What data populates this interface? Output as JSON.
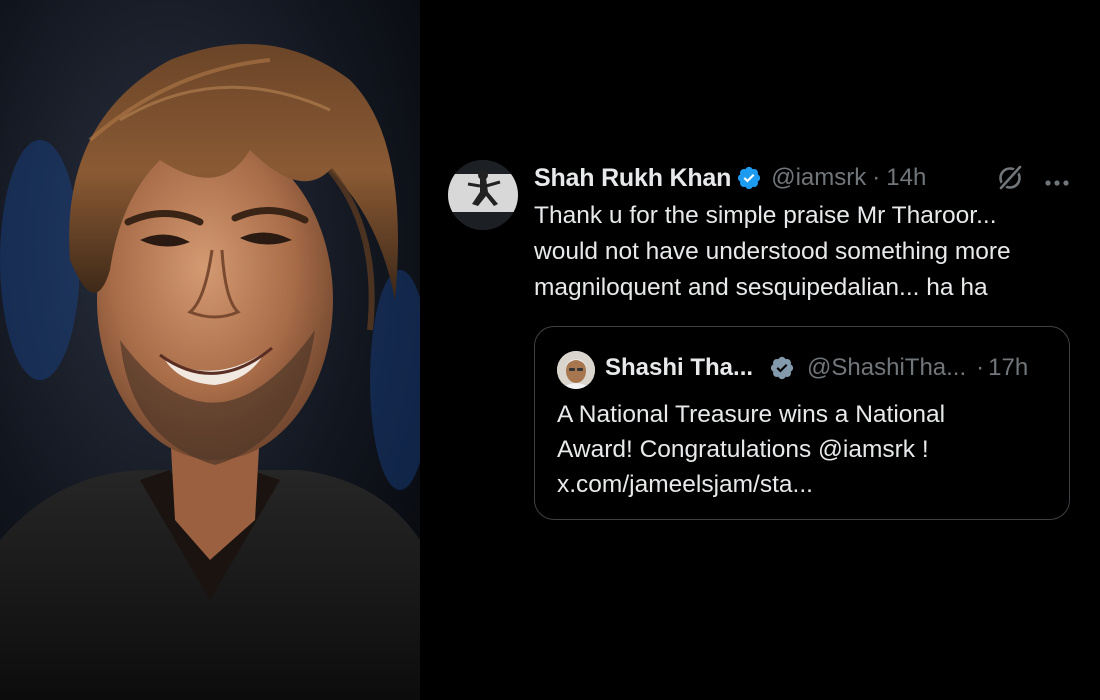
{
  "photo": {
    "subject": "portrait-photo"
  },
  "tweet": {
    "author_name": "Shah Rukh Khan",
    "author_handle": "@iamsrk",
    "separator": "·",
    "time": "14h",
    "verified_icon": "verified-badge-icon",
    "verified_color": "#1d9bf0",
    "body": "Thank u for the simple praise Mr Tharoor...\nwould not have understood something more\nmagniloquent and sesquipedalian... ha ha",
    "grok_icon": "grok-icon",
    "more_icon": "more-options-icon"
  },
  "quote": {
    "author_name": "Shashi Tha...",
    "author_handle": "@ShashiTha...",
    "separator": "·",
    "time": "17h",
    "verified_icon": "verified-badge-icon",
    "verified_color": "#829aab",
    "body": "A National Treasure wins a National\nAward! Congratulations @iamsrk !\nx.com/jameelsjam/sta..."
  },
  "colors": {
    "background": "#000000",
    "primary_text": "#e7e9ea",
    "secondary_text": "#71767b",
    "card_border": "#3e4144"
  }
}
